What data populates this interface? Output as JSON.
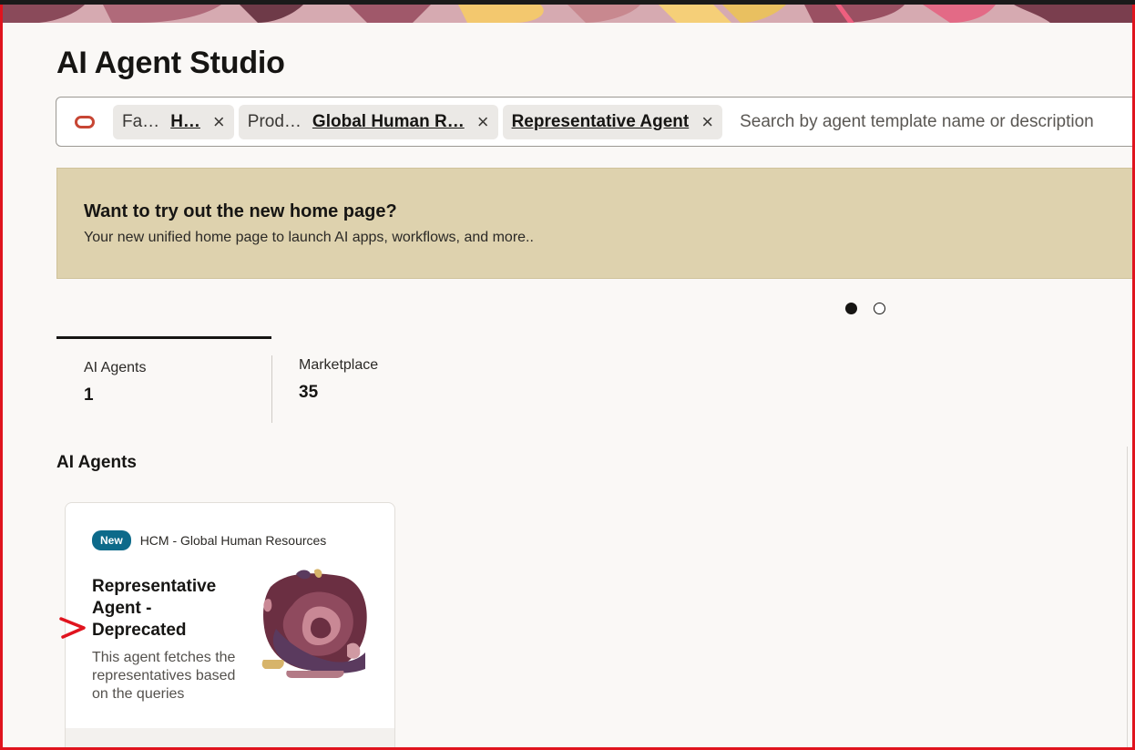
{
  "page": {
    "title": "AI Agent Studio"
  },
  "search": {
    "chips": [
      {
        "key": "Fa…",
        "value": "H…"
      },
      {
        "key": "Prod…",
        "value": "Global Human R…"
      },
      {
        "key": "",
        "value": "Representative Agent"
      }
    ],
    "remove_icon": "×",
    "placeholder": "Search by agent template name or description"
  },
  "promo": {
    "heading": "Want to try out the new home page?",
    "text": "Your new unified home page to launch AI apps, workflows, and more.."
  },
  "carousel": {
    "count": 2,
    "active_index": 0
  },
  "tabs": [
    {
      "label": "AI Agents",
      "count": "1"
    },
    {
      "label": "Marketplace",
      "count": "35"
    }
  ],
  "section": {
    "title": "AI Agents"
  },
  "card": {
    "badge": "New",
    "category": "HCM - Global Human Resources",
    "title": "Representative Agent - Deprecated",
    "description": "This agent fetches the representatives based on the queries"
  },
  "colors": {
    "accent_red": "#c74634",
    "badge_blue": "#0d6a8a",
    "promo_bg": "#ded2ae",
    "annotation_red": "#e0141e"
  }
}
